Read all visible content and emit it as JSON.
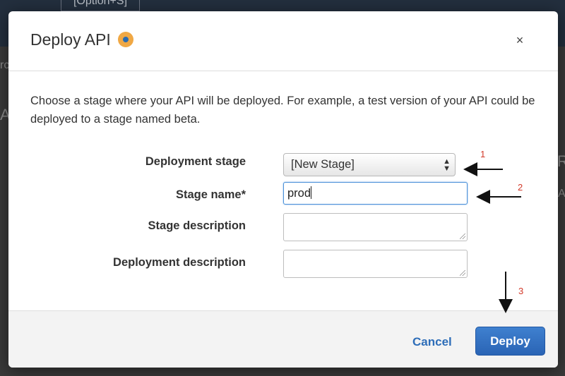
{
  "background": {
    "menu_fragment": "[Option+S]",
    "left_fragment_1": "rc",
    "left_fragment_2": "A",
    "right_fragment_1": "R",
    "right_fragment_2": "A"
  },
  "modal": {
    "title": "Deploy API",
    "close_symbol": "×",
    "intro_text": "Choose a stage where your API will be deployed. For example, a test version of your API could be deployed to a stage named beta.",
    "fields": {
      "deployment_stage": {
        "label": "Deployment stage",
        "selected": "[New Stage]",
        "arrows": "▲▼"
      },
      "stage_name": {
        "label": "Stage name*",
        "value": "prod"
      },
      "stage_description": {
        "label": "Stage description",
        "value": ""
      },
      "deployment_description": {
        "label": "Deployment description",
        "value": ""
      }
    },
    "footer": {
      "cancel_label": "Cancel",
      "deploy_label": "Deploy"
    }
  },
  "annotations": {
    "step1": "1",
    "step2": "2",
    "step3": "3",
    "color": "#d23a2a"
  },
  "colors": {
    "accent": "#2d6db8",
    "primary_button": "#2a64b5",
    "title_icon": "#f0a844",
    "header_bar": "#232f3e"
  }
}
